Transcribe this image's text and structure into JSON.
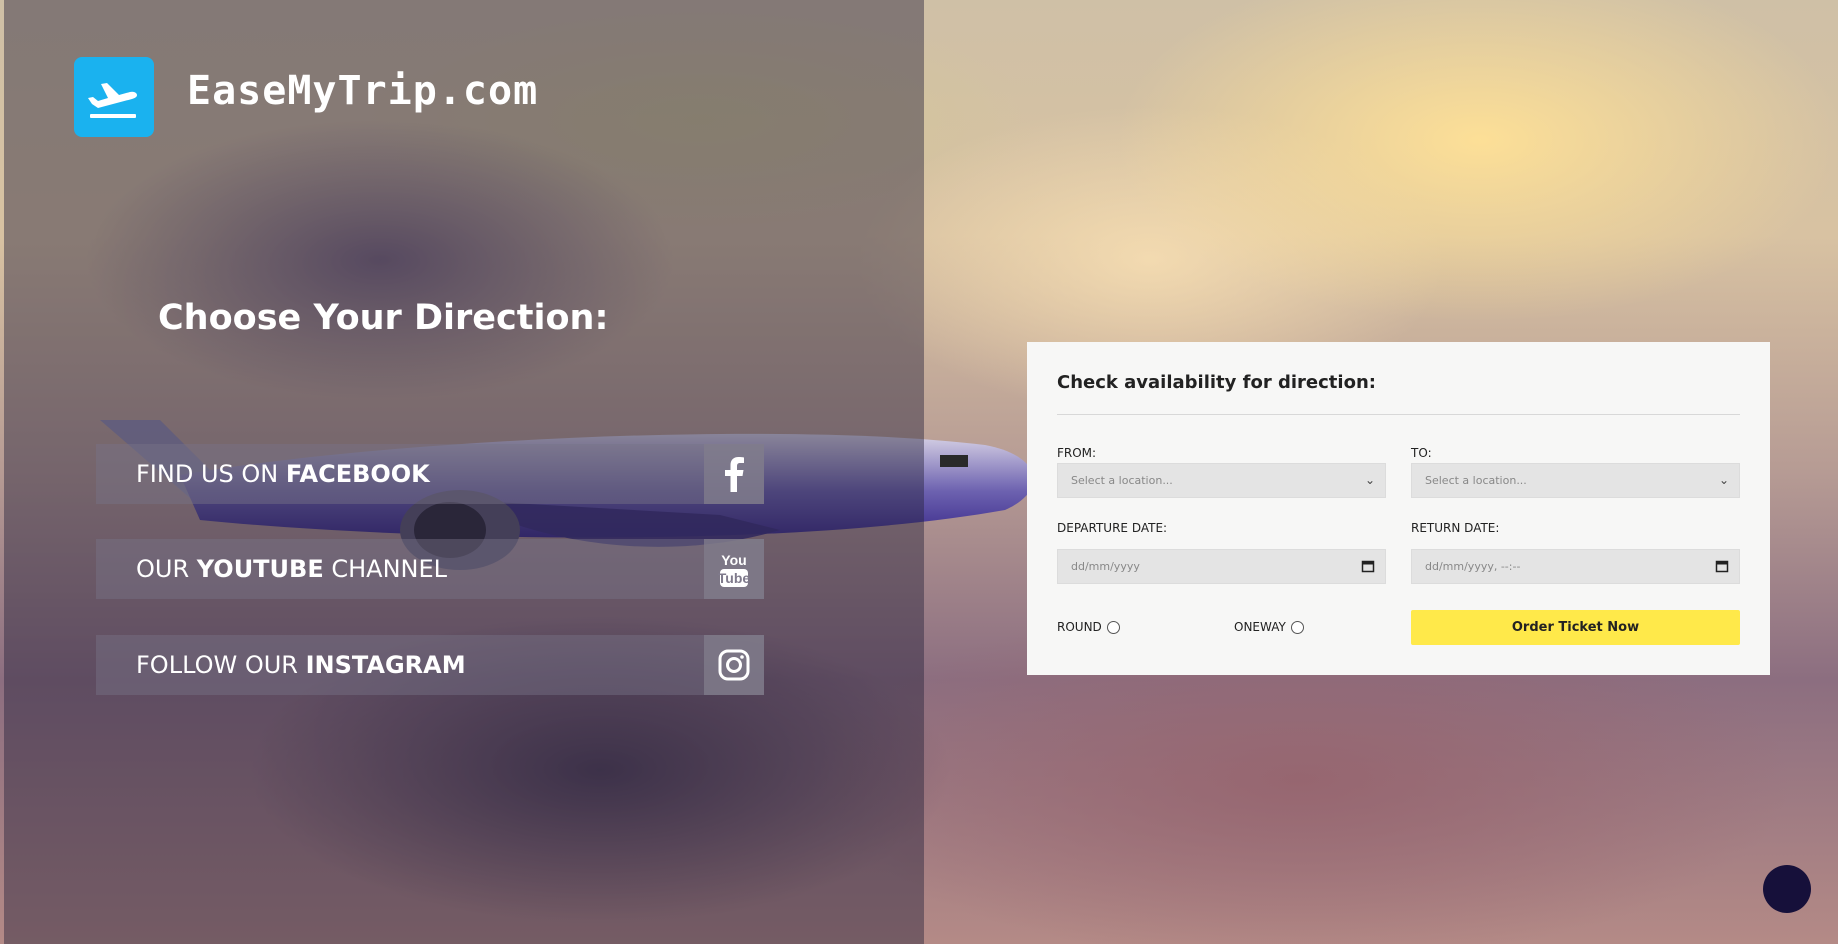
{
  "brand": {
    "name": "EaseMyTrip.com",
    "logo_icon": "airplane-takeoff-icon",
    "logo_color": "#1ab2ef"
  },
  "left": {
    "heading": "Choose Your Direction:",
    "social": [
      {
        "prefix": "FIND US ON ",
        "bold": "FACEBOOK",
        "suffix": "",
        "icon": "facebook-icon"
      },
      {
        "prefix": "OUR ",
        "bold": "YOUTUBE",
        "suffix": " CHANNEL",
        "icon": "youtube-icon"
      },
      {
        "prefix": "FOLLOW OUR ",
        "bold": "INSTAGRAM",
        "suffix": "",
        "icon": "instagram-icon"
      }
    ]
  },
  "form": {
    "title": "Check availability for direction:",
    "from_label": "FROM:",
    "from_placeholder": "Select a location...",
    "to_label": "TO:",
    "to_placeholder": "Select a location...",
    "departure_label": "DEPARTURE DATE:",
    "departure_placeholder": "dd/mm/yyyy",
    "return_label": "RETURN DATE:",
    "return_placeholder": "dd/mm/yyyy, --:--",
    "round_label": "ROUND",
    "oneway_label": "ONEWAY",
    "submit_label": "Order Ticket Now",
    "accent_color": "#ffe94a"
  }
}
